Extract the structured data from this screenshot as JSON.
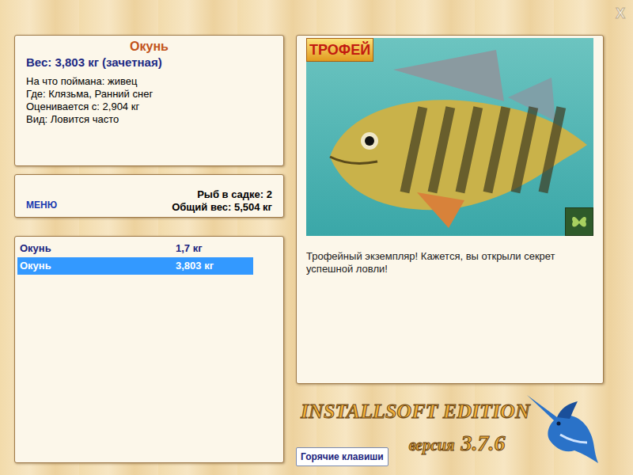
{
  "window": {
    "close": "X"
  },
  "fish_card": {
    "title": "Окунь",
    "weight": "Вес: 3,803 кг (зачетная)",
    "details": [
      "На что поймана: живец",
      "Где: Клязьма, Ранний снег",
      "Оценивается с: 2,904 кг",
      "Вид: Ловится часто"
    ]
  },
  "menu_button": "МЕНЮ",
  "keepnet": {
    "count": "Рыб в садке: 2",
    "total": "Общий вес: 5,504 кг"
  },
  "catch_list": [
    {
      "name": "Окунь",
      "weight": "1,7 кг",
      "selected": false
    },
    {
      "name": "Окунь",
      "weight": "3,803 кг",
      "selected": true
    }
  ],
  "photo": {
    "badge": "ТРОФЕЙ"
  },
  "description": "Трофейный экземпляр! Кажется, вы открыли секрет успешной ловли!",
  "logo": {
    "title": "INSTALLSOFT EDITION",
    "version_label": "версия",
    "version": "3.7.6"
  },
  "hotkeys_button": "Горячие клавиши"
}
